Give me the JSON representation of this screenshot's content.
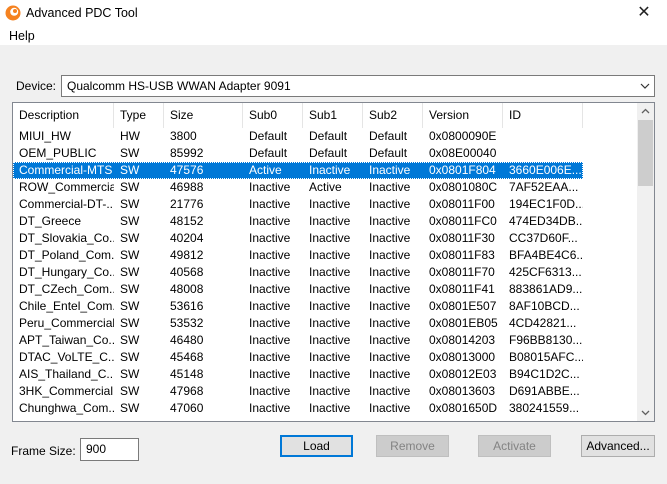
{
  "window": {
    "title": "Advanced PDC Tool",
    "close_symbol": "✕",
    "icon": "app-logo-icon"
  },
  "menu": {
    "help": "Help"
  },
  "device": {
    "label": "Device:",
    "value": "Qualcomm HS-USB WWAN Adapter 9091"
  },
  "table": {
    "columns": [
      "Description",
      "Type",
      "Size",
      "Sub0",
      "Sub1",
      "Sub2",
      "Version",
      "ID"
    ],
    "selected_index": 2,
    "rows": [
      [
        "MIUI_HW",
        "HW",
        "3800",
        "Default",
        "Default",
        "Default",
        "0x0800090E",
        ""
      ],
      [
        "OEM_PUBLIC",
        "SW",
        "85992",
        "Default",
        "Default",
        "Default",
        "0x08E00040",
        ""
      ],
      [
        "Commercial-MTS",
        "SW",
        "47576",
        "Active",
        "Inactive",
        "Inactive",
        "0x0801F804",
        "3660E006E..."
      ],
      [
        "ROW_Commercial",
        "SW",
        "46988",
        "Inactive",
        "Active",
        "Inactive",
        "0x0801080C",
        "7AF52EAA..."
      ],
      [
        "Commercial-DT-...",
        "SW",
        "21776",
        "Inactive",
        "Inactive",
        "Inactive",
        "0x08011F00",
        "194EC1F0D..."
      ],
      [
        "DT_Greece",
        "SW",
        "48152",
        "Inactive",
        "Inactive",
        "Inactive",
        "0x08011FC0",
        "474ED34DB..."
      ],
      [
        "DT_Slovakia_Co...",
        "SW",
        "40204",
        "Inactive",
        "Inactive",
        "Inactive",
        "0x08011F30",
        "CC37D60F..."
      ],
      [
        "DT_Poland_Com...",
        "SW",
        "49812",
        "Inactive",
        "Inactive",
        "Inactive",
        "0x08011F83",
        "BFA4BE4C6..."
      ],
      [
        "DT_Hungary_Co...",
        "SW",
        "40568",
        "Inactive",
        "Inactive",
        "Inactive",
        "0x08011F70",
        "425CF6313..."
      ],
      [
        "DT_CZech_Com...",
        "SW",
        "48008",
        "Inactive",
        "Inactive",
        "Inactive",
        "0x08011F41",
        "883861AD9..."
      ],
      [
        "Chile_Entel_Com...",
        "SW",
        "53616",
        "Inactive",
        "Inactive",
        "Inactive",
        "0x0801E507",
        "8AF10BCD..."
      ],
      [
        "Peru_Commercial",
        "SW",
        "53532",
        "Inactive",
        "Inactive",
        "Inactive",
        "0x0801EB05",
        "4CD42821..."
      ],
      [
        "APT_Taiwan_Co...",
        "SW",
        "46480",
        "Inactive",
        "Inactive",
        "Inactive",
        "0x08014203",
        "F96BB8130..."
      ],
      [
        "DTAC_VoLTE_C...",
        "SW",
        "45468",
        "Inactive",
        "Inactive",
        "Inactive",
        "0x08013000",
        "B08015AFC..."
      ],
      [
        "AIS_Thailand_C...",
        "SW",
        "45148",
        "Inactive",
        "Inactive",
        "Inactive",
        "0x08012E03",
        "B94C1D2C..."
      ],
      [
        "3HK_Commercial...",
        "SW",
        "47968",
        "Inactive",
        "Inactive",
        "Inactive",
        "0x08013603",
        "D691ABBE..."
      ],
      [
        "Chunghwa_Com...",
        "SW",
        "47060",
        "Inactive",
        "Inactive",
        "Inactive",
        "0x0801650D",
        "380241559..."
      ]
    ]
  },
  "frame_size": {
    "label": "Frame Size:",
    "value": "900"
  },
  "buttons": {
    "load": "Load",
    "remove": "Remove",
    "activate": "Activate",
    "advanced": "Advanced..."
  },
  "colors": {
    "selection": "#0078d7",
    "logo": "#f58220"
  }
}
